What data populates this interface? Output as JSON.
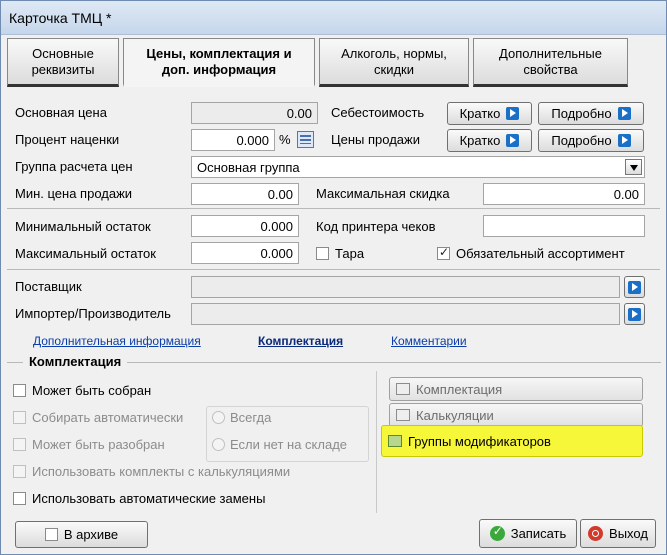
{
  "window": {
    "title": "Карточка ТМЦ *"
  },
  "tabs": [
    {
      "label": "Основные\nреквизиты"
    },
    {
      "label": "Цены, комплектация и\nдоп. информация"
    },
    {
      "label": "Алкоголь, нормы,\nскидки"
    },
    {
      "label": "Дополнительные\nсвойства"
    }
  ],
  "prices": {
    "base_price_label": "Основная цена",
    "base_price_value": "0.00",
    "markup_label": "Процент наценки",
    "markup_value": "0.000",
    "markup_unit": "%",
    "price_group_label": "Группа расчета цен",
    "price_group_value": "Основная группа",
    "min_sale_price_label": "Мин. цена продажи",
    "min_sale_price_value": "0.00",
    "cost_label": "Себестоимость",
    "sales_price_label": "Цены продажи",
    "brief_button": "Кратко",
    "detail_button": "Подробно",
    "max_discount_label": "Максимальная скидка",
    "max_discount_value": "0.00"
  },
  "stock": {
    "min_stock_label": "Минимальный остаток",
    "min_stock_value": "0.000",
    "max_stock_label": "Максимальный остаток",
    "max_stock_value": "0.000",
    "printer_code_label": "Код принтера чеков",
    "printer_code_value": "",
    "container_label": "Тара",
    "mandatory_assortment_label": "Обязательный ассортимент"
  },
  "supplier": {
    "supplier_label": "Поставщик",
    "importer_label": "Импортер/Производитель"
  },
  "links": {
    "extra_info": "Дополнительная информация",
    "assembly": "Комплектация",
    "comments": "Комментарии"
  },
  "assembly": {
    "legend": "Комплектация",
    "can_assemble": "Может быть собран",
    "auto_assemble": "Собирать автоматически",
    "can_disassemble": "Может быть разобран",
    "use_kits_with_calc": "Использовать комплекты с калькуляциями",
    "use_auto_replacements": "Использовать автоматические замены",
    "radio_always": "Всегда",
    "radio_if_not_in_stock": "Если нет на складе",
    "btn_assembly": "Комплектация",
    "btn_calculations": "Калькуляции",
    "btn_modifier_groups": "Группы модификаторов"
  },
  "footer": {
    "archive_label": "В архиве",
    "save_button": "Записать",
    "exit_button": "Выход"
  },
  "colors": {
    "highlight": "#f7f73a",
    "accent_arrow": "#1a6fc6",
    "link": "#0b3ea8"
  }
}
